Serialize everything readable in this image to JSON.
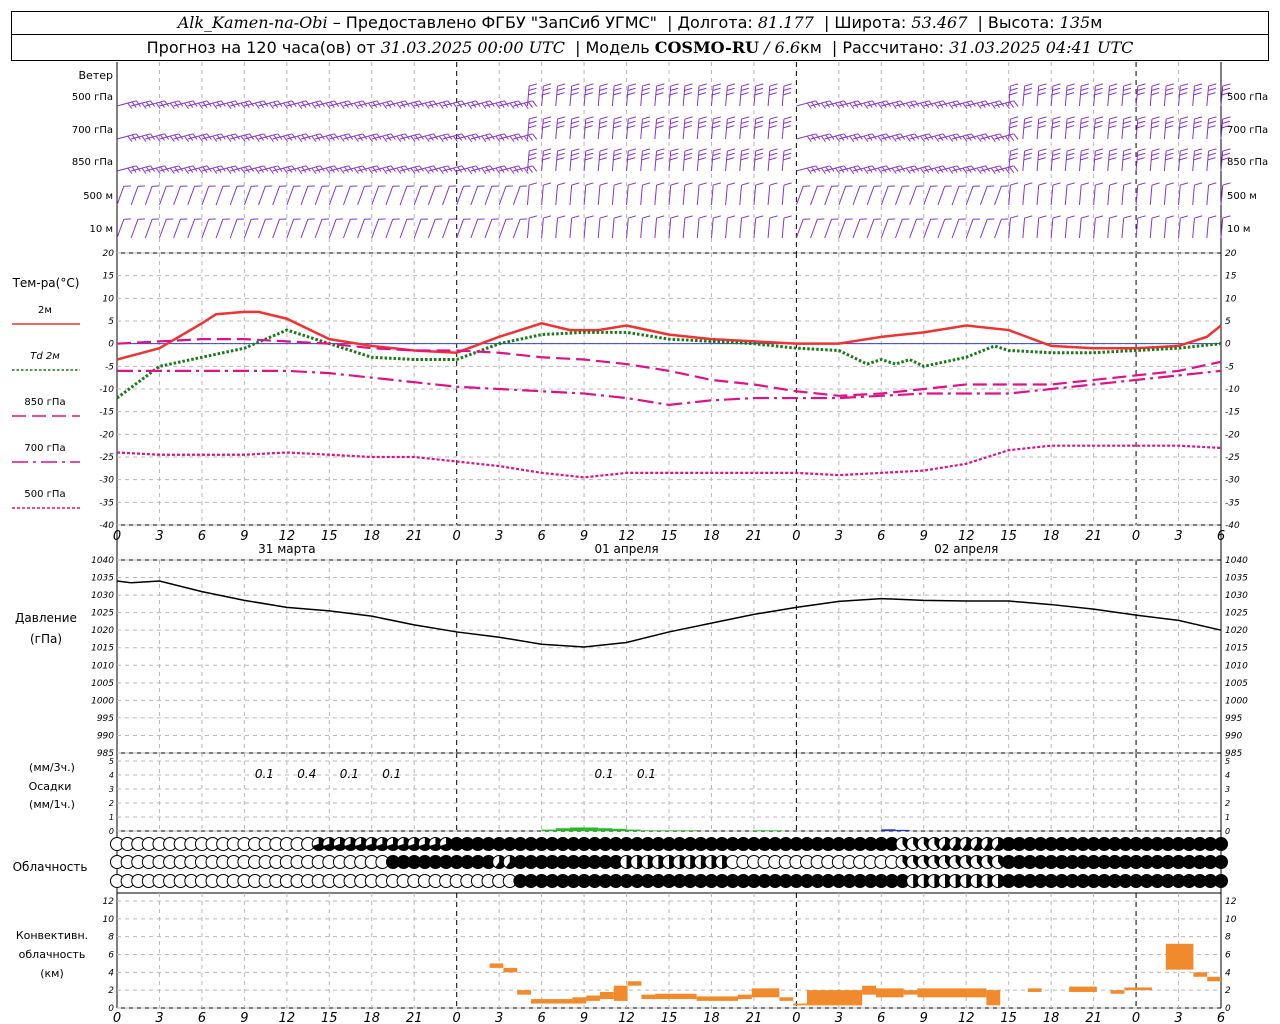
{
  "header": {
    "station": "Alk_Kamen-na-Obi",
    "provider": "– Предоставлено ФГБУ \"ЗапСиб УГМС\"",
    "lon_label": "Долгота:",
    "lon_value": "81.177",
    "lat_label": "Широта:",
    "lat_value": "53.467",
    "alt_label": "Высота:",
    "alt_value": "135",
    "alt_unit": "м",
    "forecast_prefix": "Прогноз на 120 часа(ов) от",
    "forecast_time": "31.03.2025 00:00 UTC",
    "model_label": "Модель",
    "model_name": "COSMO-RU",
    "model_res": "/ 6.6",
    "model_res_unit": "км",
    "calc_label": "Рассчитано:",
    "calc_time": "31.03.2025 04:41 UTC"
  },
  "time_axis": {
    "hour_labels": [
      "0",
      "3",
      "6",
      "9",
      "12",
      "15",
      "18",
      "21",
      "0",
      "3",
      "6",
      "9",
      "12",
      "15",
      "18",
      "21",
      "0",
      "3",
      "6",
      "9",
      "12",
      "15",
      "18",
      "21",
      "0",
      "3",
      "6"
    ],
    "date_labels": [
      "31 марта",
      "01 апреля",
      "02 апреля"
    ]
  },
  "panels": {
    "wind": {
      "title": "Ветер",
      "levels": [
        "500 гПа",
        "700 гПа",
        "850 гПа",
        "500 м",
        "10  м"
      ]
    },
    "temperature": {
      "title": "Тем-ра(°C)",
      "legend": [
        {
          "label": "2м",
          "color": "#ee3333"
        },
        {
          "label": "Td  2м",
          "color": "#1a7a1a"
        },
        {
          "label": "850 гПа",
          "color": "#dd1188"
        },
        {
          "label": "700 гПа",
          "color": "#dd1188"
        },
        {
          "label": "500 гПа",
          "color": "#dd1188"
        }
      ],
      "ticks": [
        "20",
        "15",
        "10",
        "5",
        "0",
        "-5",
        "-10",
        "-15",
        "-20",
        "-25",
        "-30",
        "-35",
        "-40"
      ]
    },
    "pressure": {
      "title": "Давление",
      "unit": "(гПа)",
      "ticks": [
        "1040",
        "1035",
        "1030",
        "1025",
        "1020",
        "1015",
        "1010",
        "1005",
        "1000",
        "995",
        "990",
        "985"
      ]
    },
    "precip": {
      "unit_top": "(мм/3ч.)",
      "title": "Осадки",
      "unit_bottom": "(мм/1ч.)",
      "ticks": [
        "5",
        "4",
        "3",
        "2",
        "1",
        "0"
      ],
      "amounts": [
        {
          "text": "0.1",
          "x": 9.0
        },
        {
          "text": "0.4",
          "x": 12.0
        },
        {
          "text": "0.1",
          "x": 15.0
        },
        {
          "text": "0.1",
          "x": 18.0
        },
        {
          "text": "0.1",
          "x": 33.0
        },
        {
          "text": "0.1",
          "x": 36.0
        }
      ]
    },
    "clouds": {
      "title": "Облачность"
    },
    "convective": {
      "title_1": "Конвективн.",
      "title_2": "облачность",
      "unit": "(км)",
      "ticks": [
        "12",
        "10",
        "8",
        "6",
        "4",
        "2",
        "0"
      ]
    }
  },
  "chart_data": [
    {
      "type": "line",
      "title": "Тем-ра(°C)",
      "x_unit": "hours",
      "xlim": [
        0,
        78
      ],
      "ylim": [
        -40,
        20
      ],
      "series": [
        {
          "name": "2м",
          "color": "#ee3333",
          "style": "solid",
          "x": [
            0,
            3,
            6,
            7,
            9,
            10,
            12,
            15,
            18,
            21,
            24,
            27,
            30,
            32,
            34,
            36,
            39,
            42,
            45,
            48,
            51,
            54,
            57,
            60,
            63,
            66,
            69,
            72,
            75,
            77,
            78
          ],
          "y": [
            -3.5,
            -1,
            4.5,
            6.5,
            7,
            7,
            5.5,
            1,
            -0.5,
            -1.5,
            -2,
            1.5,
            4.5,
            3,
            3,
            4,
            2,
            1,
            0.5,
            0,
            0,
            1.5,
            2.5,
            4,
            3,
            -0.5,
            -1,
            -1,
            -0.5,
            1.5,
            4
          ]
        },
        {
          "name": "Td  2м",
          "color": "#1a7a1a",
          "style": "dotted",
          "x": [
            0,
            3,
            6,
            9,
            12,
            15,
            18,
            21,
            24,
            27,
            30,
            33,
            36,
            39,
            42,
            45,
            48,
            51,
            53,
            54,
            55,
            56,
            57,
            60,
            62,
            63,
            66,
            69,
            72,
            75,
            78
          ],
          "y": [
            -12,
            -5,
            -3,
            -1,
            3,
            0,
            -3,
            -3.5,
            -3.5,
            0,
            2,
            2.5,
            2.5,
            1,
            0.5,
            0,
            -1,
            -1.5,
            -4.5,
            -3.5,
            -4.5,
            -3.5,
            -5,
            -3,
            -0.5,
            -1.5,
            -2,
            -2,
            -1.5,
            -1,
            0
          ]
        },
        {
          "name": "850 гПа",
          "color": "#dd1188",
          "style": "dashed",
          "x": [
            0,
            3,
            6,
            9,
            12,
            15,
            18,
            21,
            24,
            27,
            30,
            33,
            36,
            39,
            42,
            45,
            48,
            51,
            54,
            57,
            60,
            63,
            66,
            69,
            72,
            75,
            78
          ],
          "y": [
            0,
            0.5,
            1,
            1,
            0.5,
            0,
            -1,
            -1.5,
            -1.5,
            -2,
            -3,
            -3.5,
            -4.5,
            -6,
            -8,
            -9,
            -10.5,
            -11.5,
            -11,
            -10,
            -9,
            -9,
            -9,
            -8,
            -7,
            -6,
            -4
          ]
        },
        {
          "name": "700 гПа",
          "color": "#dd1188",
          "style": "dashdot",
          "x": [
            0,
            3,
            6,
            9,
            12,
            15,
            18,
            21,
            24,
            27,
            30,
            33,
            36,
            39,
            42,
            45,
            48,
            51,
            54,
            57,
            60,
            63,
            66,
            69,
            72,
            75,
            78
          ],
          "y": [
            -6,
            -6,
            -6,
            -6,
            -6,
            -6.5,
            -7.5,
            -8.5,
            -9.5,
            -10,
            -10.5,
            -11,
            -12,
            -13.5,
            -12.5,
            -12,
            -12,
            -12,
            -11.5,
            -11,
            -11,
            -11,
            -10,
            -9,
            -8,
            -7,
            -6
          ]
        },
        {
          "name": "500 гПа",
          "color": "#dd1188",
          "style": "dense",
          "x": [
            0,
            3,
            6,
            9,
            12,
            15,
            18,
            21,
            24,
            27,
            30,
            33,
            36,
            39,
            42,
            45,
            48,
            51,
            54,
            57,
            60,
            63,
            66,
            69,
            72,
            75,
            78
          ],
          "y": [
            -24,
            -24.5,
            -24.5,
            -24.5,
            -24,
            -24.5,
            -25,
            -25,
            -26,
            -27,
            -28.5,
            -29.5,
            -28.5,
            -28.5,
            -28.5,
            -28.5,
            -28.5,
            -29,
            -28.5,
            -28,
            -26.5,
            -23.5,
            -22.5,
            -22.5,
            -22.5,
            -22.5,
            -23
          ]
        }
      ]
    },
    {
      "type": "line",
      "title": "Давление",
      "x_unit": "hours",
      "xlim": [
        0,
        78
      ],
      "ylim": [
        985,
        1040
      ],
      "series": [
        {
          "name": "",
          "color": "#000000",
          "x": [
            0,
            1,
            3,
            6,
            9,
            12,
            15,
            18,
            21,
            24,
            27,
            30,
            33,
            36,
            39,
            42,
            45,
            48,
            51,
            54,
            57,
            60,
            63,
            66,
            69,
            72,
            75,
            78
          ],
          "y": [
            1034,
            1033.5,
            1034,
            1031,
            1028.5,
            1026.5,
            1025.5,
            1024,
            1021.5,
            1019.5,
            1018,
            1016,
            1015.2,
            1016.5,
            1019.5,
            1022,
            1024.5,
            1026.5,
            1028.2,
            1029,
            1028.5,
            1028.3,
            1028.3,
            1027.3,
            1026,
            1024.3,
            1022.8,
            1020
          ]
        }
      ]
    },
    {
      "type": "bar",
      "title": "Осадки",
      "x_unit": "hours",
      "ylim": [
        0,
        5
      ],
      "series": [
        {
          "name": "",
          "color": "#22bb22",
          "x": [
            30,
            31,
            32,
            33,
            34,
            35,
            36,
            37,
            38,
            39,
            40,
            41,
            42,
            43,
            44,
            45,
            46,
            47
          ],
          "values": [
            0.1,
            0.2,
            0.25,
            0.25,
            0.2,
            0.15,
            0.1,
            0.05,
            0.05,
            0.05,
            0.05,
            0,
            0,
            0,
            0,
            0.05,
            0.05,
            0
          ]
        },
        {
          "name": "",
          "color": "#2233bb",
          "x": [
            54,
            55
          ],
          "values": [
            0.12,
            0.08
          ]
        }
      ]
    },
    {
      "type": "bar",
      "title": "Конвективн. облачность",
      "x_unit": "hours",
      "ylim": [
        0,
        12
      ],
      "series": [
        {
          "name": "",
          "color": "#f08a2c",
          "bars": [
            [
              27,
              28,
              4.5,
              5
            ],
            [
              28,
              29,
              4,
              4.5
            ],
            [
              29,
              30,
              1.5,
              2
            ],
            [
              30,
              33,
              0.5,
              1
            ],
            [
              33,
              34,
              0.5,
              1.2
            ],
            [
              34,
              35,
              0.8,
              1.4
            ],
            [
              35,
              36,
              1,
              1.8
            ],
            [
              36,
              37,
              0.8,
              2.5
            ],
            [
              37,
              38,
              2.5,
              3
            ],
            [
              38,
              39,
              1,
              1.5
            ],
            [
              39,
              42,
              1,
              1.6
            ],
            [
              42,
              45,
              0.8,
              1.3
            ],
            [
              45,
              46,
              1,
              1.5
            ],
            [
              46,
              48,
              1.2,
              2.2
            ],
            [
              48,
              49,
              0.8,
              1.2
            ],
            [
              49,
              50,
              0.3,
              0.5
            ],
            [
              50,
              54,
              0.3,
              2
            ],
            [
              54,
              55,
              1.5,
              2.5
            ],
            [
              55,
              57,
              1.2,
              2.2
            ],
            [
              57,
              58,
              1.5,
              2
            ],
            [
              58,
              63,
              1.2,
              2.2
            ],
            [
              63,
              64,
              0.3,
              2
            ],
            [
              66,
              67,
              1.8,
              2.2
            ],
            [
              69,
              71,
              1.8,
              2.4
            ],
            [
              72,
              73,
              1.6,
              2
            ],
            [
              73,
              75,
              2,
              2.3
            ],
            [
              76,
              78,
              4.3,
              7.2
            ],
            [
              78,
              79,
              3.5,
              4
            ],
            [
              79,
              80,
              3,
              3.5
            ]
          ]
        }
      ]
    }
  ]
}
